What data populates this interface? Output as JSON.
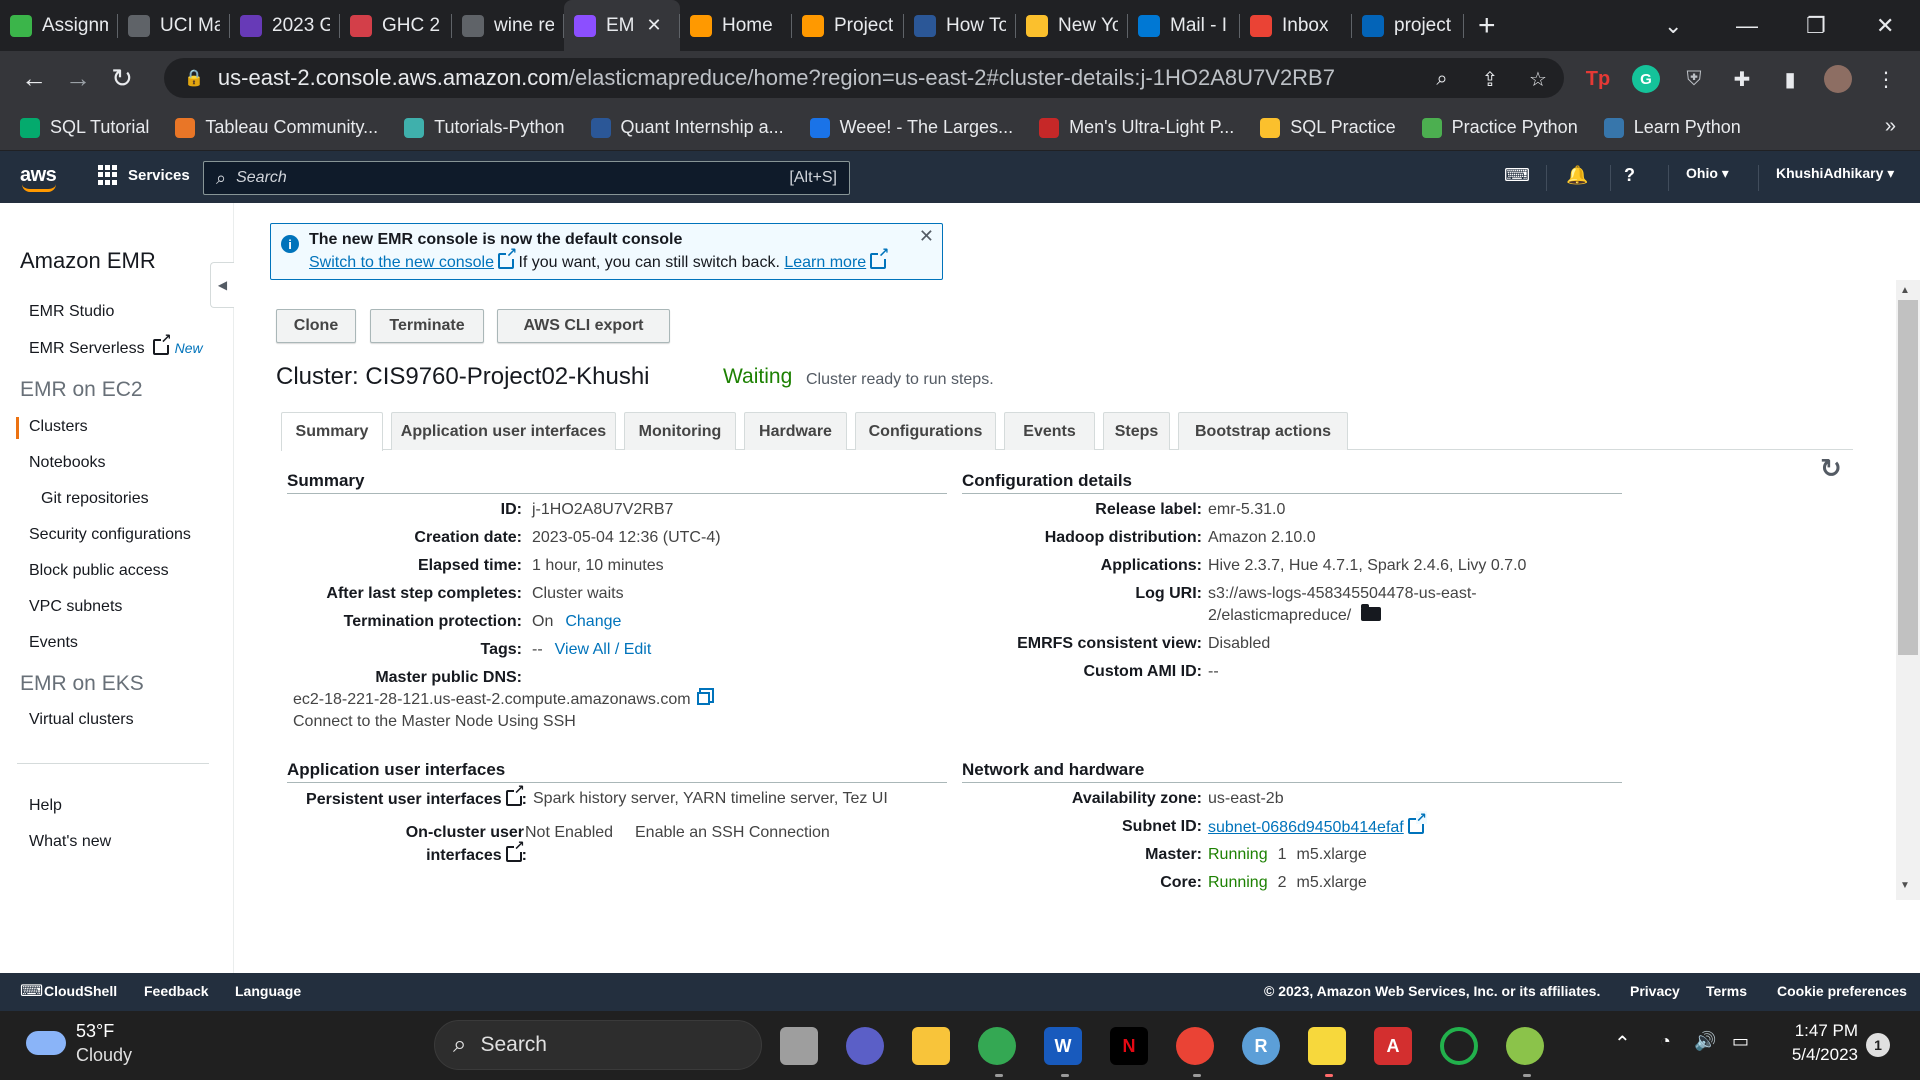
{
  "browser": {
    "tabs": [
      {
        "title": "Assignm",
        "icon": "dc-icon",
        "color": "#3bb54a"
      },
      {
        "title": "UCI Ma",
        "icon": "globe-icon",
        "color": "#5f6368"
      },
      {
        "title": "2023 G",
        "icon": "form-icon",
        "color": "#673ab7"
      },
      {
        "title": "GHC 2",
        "icon": "ghc-icon",
        "color": "#d33f49"
      },
      {
        "title": "wine re",
        "icon": "globe-icon",
        "color": "#5f6368"
      },
      {
        "title": "EM",
        "icon": "emr-icon",
        "color": "#8c4fff",
        "active": true
      },
      {
        "title": "Home",
        "icon": "home-icon",
        "color": "#ff9900"
      },
      {
        "title": "Project",
        "icon": "project-icon",
        "color": "#ff9900"
      },
      {
        "title": "How To",
        "icon": "tds-icon",
        "color": "#2b5797"
      },
      {
        "title": "New Yo",
        "icon": "weather-icon",
        "color": "#fbc02d"
      },
      {
        "title": "Mail - I",
        "icon": "outlook-icon",
        "color": "#0078d4"
      },
      {
        "title": "Inbox",
        "icon": "gmail-icon",
        "color": "#ea4335"
      },
      {
        "title": "project",
        "icon": "onedrive-icon",
        "color": "#0364b8"
      }
    ],
    "active_tab_close": "✕",
    "new_tab": "+",
    "url_host": "us-east-2.console.aws.amazon.com",
    "url_path": "/elasticmapreduce/home?region=us-east-2#cluster-details:j-1HO2A8U7V2RB7",
    "bookmarks": [
      {
        "label": "SQL Tutorial",
        "icon": "w3-icon",
        "color": "#04aa6d"
      },
      {
        "label": "Tableau Community...",
        "icon": "tableau-icon",
        "color": "#e97627"
      },
      {
        "label": "Tutorials-Python",
        "icon": "python-icon",
        "color": "#3fb0ac"
      },
      {
        "label": "Quant Internship a...",
        "icon": "quant-icon",
        "color": "#2b5797"
      },
      {
        "label": "Weee! - The Larges...",
        "icon": "weee-icon",
        "color": "#1a73e8"
      },
      {
        "label": "Men's Ultra-Light P...",
        "icon": "brand-icon",
        "color": "#c62828"
      },
      {
        "label": "SQL Practice",
        "icon": "key-icon",
        "color": "#fbc02d"
      },
      {
        "label": "Practice Python",
        "icon": "practice-icon",
        "color": "#4caf50"
      },
      {
        "label": "Learn Python",
        "icon": "python-icon",
        "color": "#3776ab"
      }
    ],
    "bookmarks_more": "»"
  },
  "aws_header": {
    "logo": "aws",
    "services": "Services",
    "search_placeholder": "Search",
    "search_shortcut": "[Alt+S]",
    "region": "Ohio ▾",
    "account": "KhushiAdhikary ▾"
  },
  "sidebar": {
    "title": "Amazon EMR",
    "items_top": [
      "EMR Studio",
      "EMR Serverless"
    ],
    "new_tag": "New",
    "section_ec2": "EMR on EC2",
    "items_ec2": [
      "Clusters",
      "Notebooks",
      "Git repositories",
      "Security configurations",
      "Block public access",
      "VPC subnets",
      "Events"
    ],
    "section_eks": "EMR on EKS",
    "items_eks": [
      "Virtual clusters"
    ],
    "items_bottom": [
      "Help",
      "What's new"
    ]
  },
  "flash": {
    "title": "The new EMR console is now the default console",
    "switch_link": "Switch to the new console",
    "middle_text": " If you want, you can still switch back. ",
    "learn_more": "Learn more",
    "close": "✕"
  },
  "actions": {
    "clone": "Clone",
    "terminate": "Terminate",
    "cli_export": "AWS CLI export"
  },
  "cluster": {
    "heading": "Cluster: CIS9760-Project02-Khushi",
    "status": "Waiting",
    "status_message": "Cluster ready to run steps."
  },
  "tabs": [
    "Summary",
    "Application user interfaces",
    "Monitoring",
    "Hardware",
    "Configurations",
    "Events",
    "Steps",
    "Bootstrap actions"
  ],
  "summary": {
    "title": "Summary",
    "id_label": "ID:",
    "id": "j-1HO2A8U7V2RB7",
    "creation_label": "Creation date:",
    "creation": "2023-05-04 12:36 (UTC-4)",
    "elapsed_label": "Elapsed time:",
    "elapsed": "1 hour, 10 minutes",
    "after_label": "After last step completes:",
    "after": "Cluster waits",
    "termination_label": "Termination protection:",
    "termination": "On",
    "termination_change": "Change",
    "tags_label": "Tags:",
    "tags": "--",
    "tags_link": "View All / Edit",
    "dns_label": "Master public DNS:",
    "dns": "ec2-18-221-28-121.us-east-2.compute.amazonaws.com",
    "ssh_link": "Connect to the Master Node Using SSH"
  },
  "config": {
    "title": "Configuration details",
    "release_label": "Release label:",
    "release": "emr-5.31.0",
    "hadoop_label": "Hadoop distribution:",
    "hadoop": "Amazon 2.10.0",
    "apps_label": "Applications:",
    "apps": "Hive 2.3.7, Hue 4.7.1, Spark 2.4.6, Livy 0.7.0",
    "log_label": "Log URI:",
    "log_line1": "s3://aws-logs-458345504478-us-east-",
    "log_line2": "2/elasticmapreduce/",
    "emrfs_label": "EMRFS consistent view:",
    "emrfs": "Disabled",
    "ami_label": "Custom AMI ID:",
    "ami": "--"
  },
  "app_ui": {
    "title": "Application user interfaces",
    "persistent_label": "Persistent user interfaces",
    "persistent_links": "Spark history server, YARN timeline server, Tez UI",
    "oncluster_label1": "On-cluster user",
    "oncluster_label2": "interfaces",
    "oncluster_value": "Not Enabled",
    "enable_ssh": "Enable an SSH Connection"
  },
  "network": {
    "title": "Network and hardware",
    "az_label": "Availability zone:",
    "az": "us-east-2b",
    "subnet_label": "Subnet ID:",
    "subnet": "subnet-0686d9450b414efaf",
    "master_label": "Master:",
    "master_state": "Running",
    "master_count": "1",
    "master_type": "m5.xlarge",
    "core_label": "Core:",
    "core_state": "Running",
    "core_count": "2",
    "core_type": "m5.xlarge"
  },
  "footer": {
    "cloudshell": "CloudShell",
    "feedback": "Feedback",
    "language": "Language",
    "copyright": "© 2023, Amazon Web Services, Inc. or its affiliates.",
    "privacy": "Privacy",
    "terms": "Terms",
    "cookies": "Cookie preferences"
  },
  "taskbar": {
    "temp": "53°F",
    "weather": "Cloudy",
    "search": "Search",
    "time": "1:47 PM",
    "date": "5/4/2023",
    "notifications": "1"
  }
}
